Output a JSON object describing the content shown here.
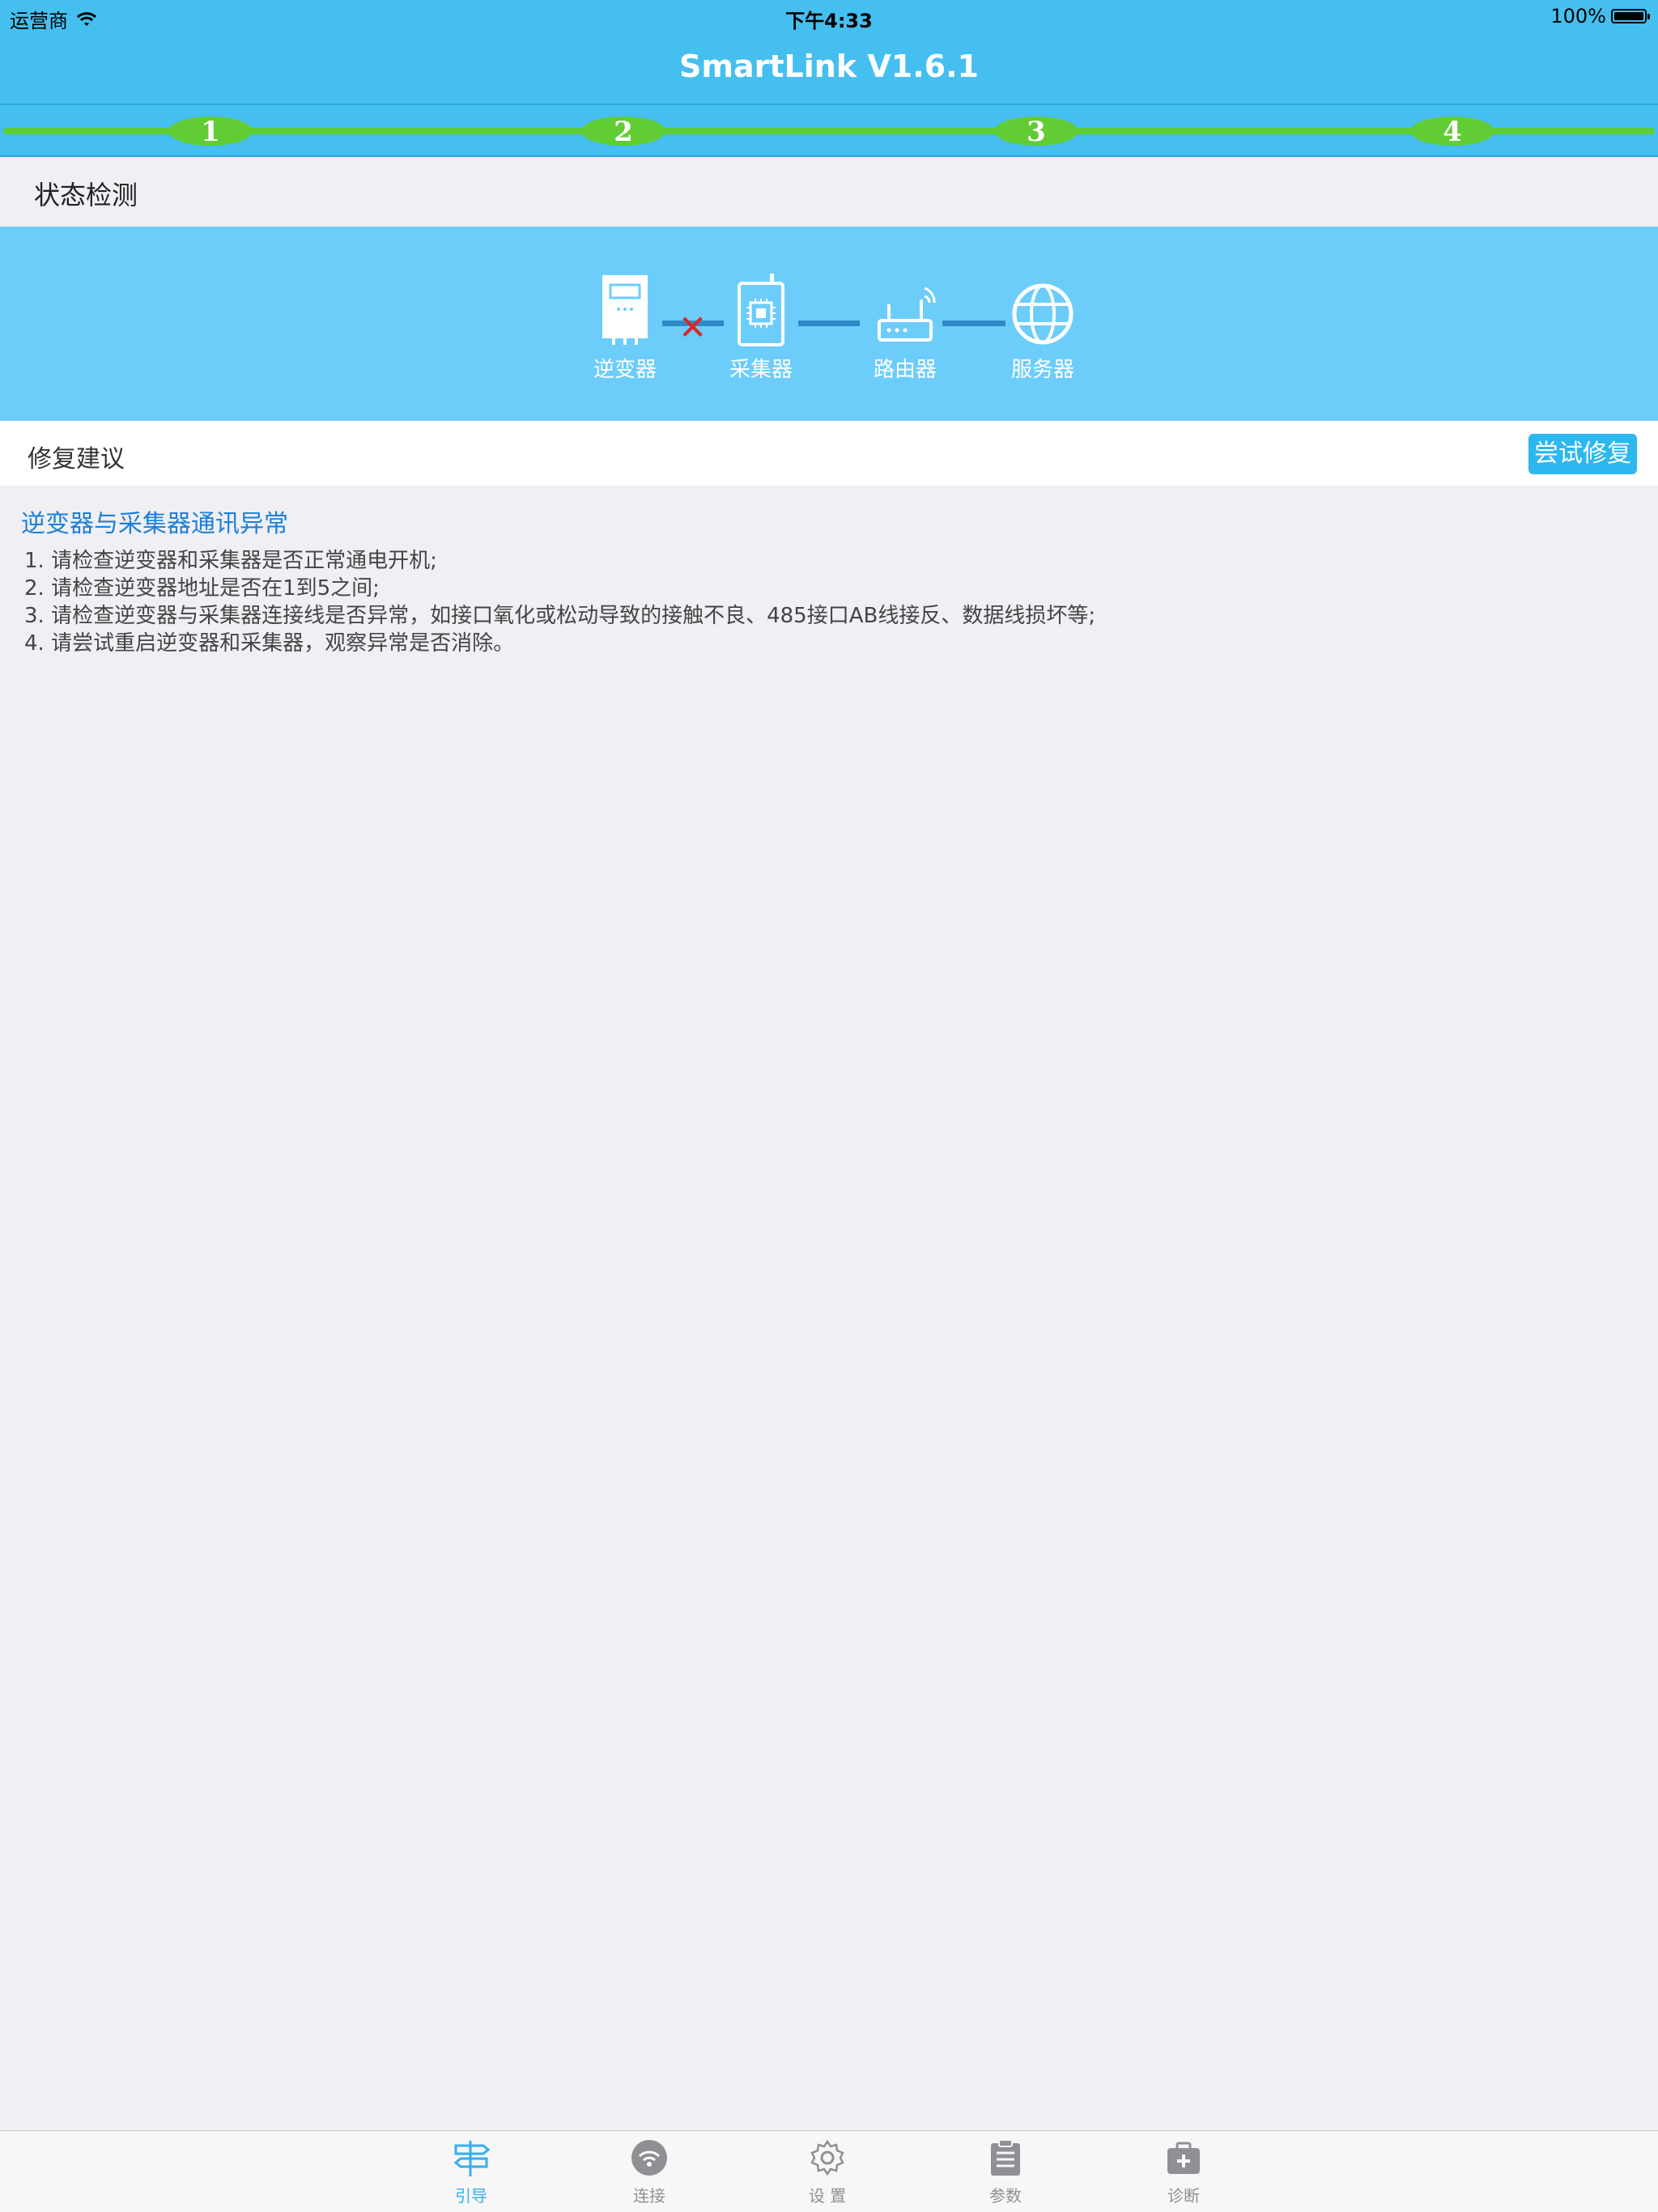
{
  "status_bar": {
    "carrier": "运营商",
    "time": "下午4:33",
    "battery": "100%"
  },
  "nav": {
    "title": "SmartLink V1.6.1"
  },
  "progress": {
    "steps": [
      "1",
      "2",
      "3",
      "4"
    ]
  },
  "status_section": {
    "title": "状态检测"
  },
  "devices": [
    {
      "label": "逆变器",
      "icon": "inverter-icon"
    },
    {
      "label": "采集器",
      "icon": "collector-icon"
    },
    {
      "label": "路由器",
      "icon": "router-icon"
    },
    {
      "label": "服务器",
      "icon": "server-globe-icon"
    }
  ],
  "repair": {
    "label": "修复建议",
    "button": "尝试修复"
  },
  "problem": {
    "title": "逆变器与采集器通讯异常",
    "steps": [
      "1. 请检查逆变器和采集器是否正常通电开机;",
      "2. 请检查逆变器地址是否在1到5之间;",
      "3. 请检查逆变器与采集器连接线是否异常，如接口氧化或松动导致的接触不良、485接口AB线接反、数据线损坏等;",
      "4. 请尝试重启逆变器和采集器，观察异常是否消除。"
    ]
  },
  "tabbar": {
    "tabs": [
      {
        "label": "引导",
        "icon": "signpost-icon",
        "active": true
      },
      {
        "label": "连接",
        "icon": "wifi-icon",
        "active": false
      },
      {
        "label": "设 置",
        "icon": "gear-icon",
        "active": false
      },
      {
        "label": "参数",
        "icon": "clipboard-icon",
        "active": false
      },
      {
        "label": "诊断",
        "icon": "medkit-icon",
        "active": false
      }
    ],
    "active_color": "#36aef0",
    "inactive_color": "#8f8f94"
  },
  "colors": {
    "header": "#45bff0",
    "device_panel": "#6ccdfb",
    "progress_green": "#5fcd35",
    "link_blue": "#1e7fd8"
  }
}
